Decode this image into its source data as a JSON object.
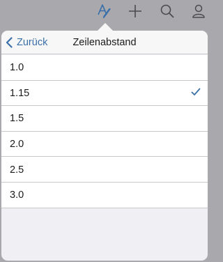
{
  "toolbar": {
    "icons": [
      "text-format-icon",
      "plus-icon",
      "search-icon",
      "user-icon"
    ]
  },
  "popover": {
    "back_label": "Zurück",
    "title": "Zeilenabstand",
    "options": [
      {
        "label": "1.0",
        "selected": false
      },
      {
        "label": "1.15",
        "selected": true
      },
      {
        "label": "1.5",
        "selected": false
      },
      {
        "label": "2.0",
        "selected": false
      },
      {
        "label": "2.5",
        "selected": false
      },
      {
        "label": "3.0",
        "selected": false
      }
    ]
  },
  "colors": {
    "accent": "#3a6fa8",
    "backdrop": "#a9a9ad",
    "separator": "#c8c7cc"
  }
}
